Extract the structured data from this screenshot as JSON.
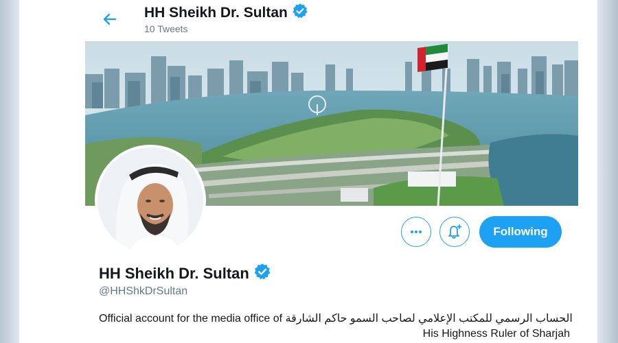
{
  "header": {
    "title": "HH Sheikh Dr. Sultan",
    "tweet_count": "10 Tweets"
  },
  "profile": {
    "display_name": "HH Sheikh Dr. Sultan",
    "handle": "@HHShkDrSultan",
    "bio_line1": "Official account for the media office of الحساب الرسمي للمكتب الإعلامي لصاحب السمو حاكم الشارقة",
    "bio_line2": "His Highness Ruler of Sharjah"
  },
  "actions": {
    "follow_label": "Following"
  },
  "colors": {
    "accent": "#1da1f2",
    "text": "#14171a",
    "muted": "#657786"
  },
  "icons": [
    "back-arrow-icon",
    "verified-badge-icon",
    "more-options-icon",
    "notification-bell-icon"
  ]
}
